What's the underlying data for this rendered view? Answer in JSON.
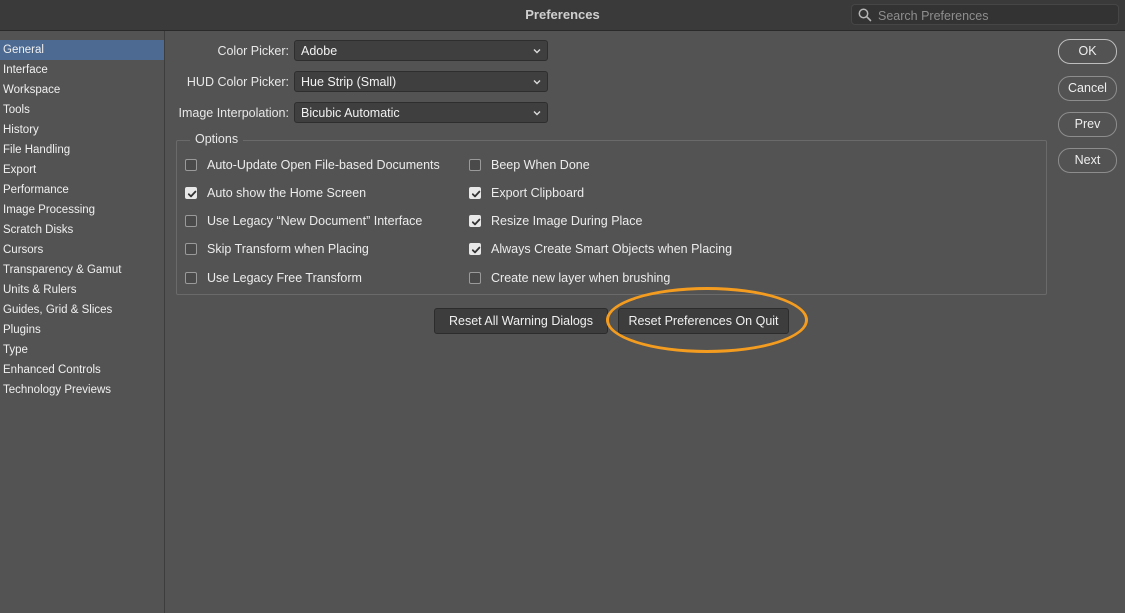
{
  "window": {
    "title": "Preferences"
  },
  "search": {
    "placeholder": "Search Preferences",
    "icon": "search-icon"
  },
  "sidebar": {
    "items": [
      {
        "label": "General",
        "active": true
      },
      {
        "label": "Interface"
      },
      {
        "label": "Workspace"
      },
      {
        "label": "Tools"
      },
      {
        "label": "History"
      },
      {
        "label": "File Handling"
      },
      {
        "label": "Export"
      },
      {
        "label": "Performance"
      },
      {
        "label": "Image Processing"
      },
      {
        "label": "Scratch Disks"
      },
      {
        "label": "Cursors"
      },
      {
        "label": "Transparency & Gamut"
      },
      {
        "label": "Units & Rulers"
      },
      {
        "label": "Guides, Grid & Slices"
      },
      {
        "label": "Plugins"
      },
      {
        "label": "Type"
      },
      {
        "label": "Enhanced Controls"
      },
      {
        "label": "Technology Previews"
      }
    ]
  },
  "fields": {
    "color_picker": {
      "label": "Color Picker:",
      "value": "Adobe"
    },
    "hud_color_picker": {
      "label": "HUD Color Picker:",
      "value": "Hue Strip (Small)"
    },
    "image_interpolation": {
      "label": "Image Interpolation:",
      "value": "Bicubic Automatic"
    }
  },
  "options": {
    "title": "Options",
    "left": [
      {
        "label": "Auto-Update Open File-based Documents",
        "checked": false
      },
      {
        "label": "Auto show the Home Screen",
        "checked": true
      },
      {
        "label": "Use Legacy “New Document” Interface",
        "checked": false
      },
      {
        "label": "Skip Transform when Placing",
        "checked": false
      },
      {
        "label": "Use Legacy Free Transform",
        "checked": false
      }
    ],
    "right": [
      {
        "label": "Beep When Done",
        "checked": false
      },
      {
        "label": "Export Clipboard",
        "checked": true
      },
      {
        "label": "Resize Image During Place",
        "checked": true
      },
      {
        "label": "Always Create Smart Objects when Placing",
        "checked": true
      },
      {
        "label": "Create new layer when brushing",
        "checked": false
      }
    ]
  },
  "actions": {
    "reset_warnings": "Reset All Warning Dialogs",
    "reset_prefs": "Reset Preferences On Quit"
  },
  "dialog_buttons": {
    "ok": "OK",
    "cancel": "Cancel",
    "prev": "Prev",
    "next": "Next"
  },
  "colors": {
    "highlight": "#f39c1f",
    "active_item": "#4c6a92",
    "background": "#535353"
  }
}
